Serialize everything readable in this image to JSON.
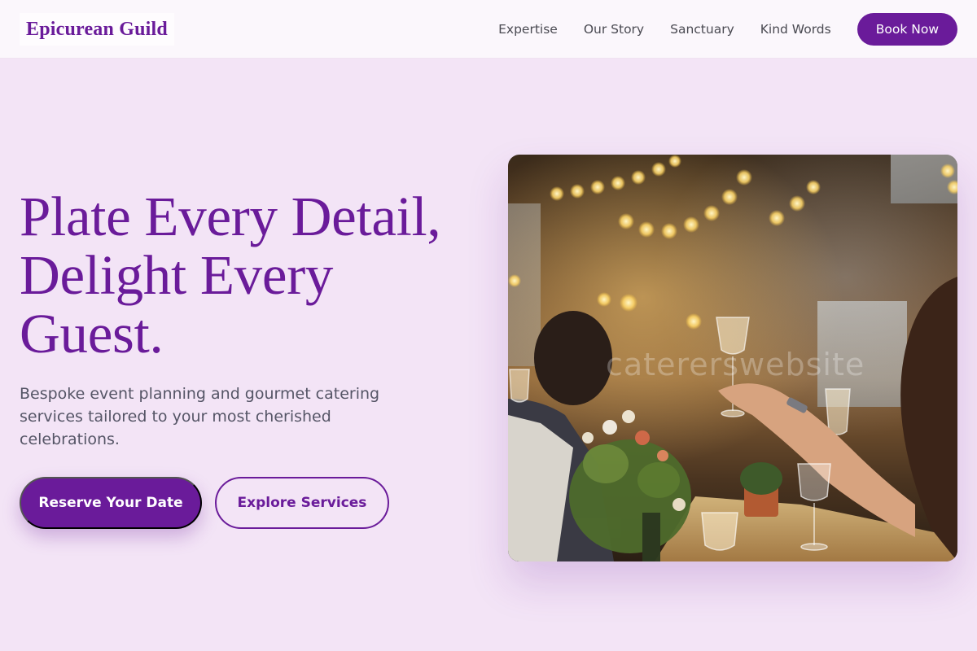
{
  "header": {
    "logo": "Epicurean Guild",
    "nav": [
      {
        "label": "Expertise"
      },
      {
        "label": "Our Story"
      },
      {
        "label": "Sanctuary"
      },
      {
        "label": "Kind Words"
      }
    ],
    "book_label": "Book Now"
  },
  "hero": {
    "title_lines": [
      "Plate Every Detail,",
      "Delight Every",
      "Guest."
    ],
    "subtitle": "Bespoke event planning and gourmet catering services tailored to your most cherished celebrations.",
    "primary_cta": "Reserve Your Date",
    "secondary_cta": "Explore Services",
    "image_watermark": "catererswebsite"
  },
  "colors": {
    "brand": "#6a1b9a",
    "page_bg": "#f3e4f6",
    "header_bg": "#fbf7fc",
    "body_text": "#555566",
    "nav_text": "#4a4a52"
  },
  "icons": {
    "hero_image": "banquet-toast-photo"
  }
}
